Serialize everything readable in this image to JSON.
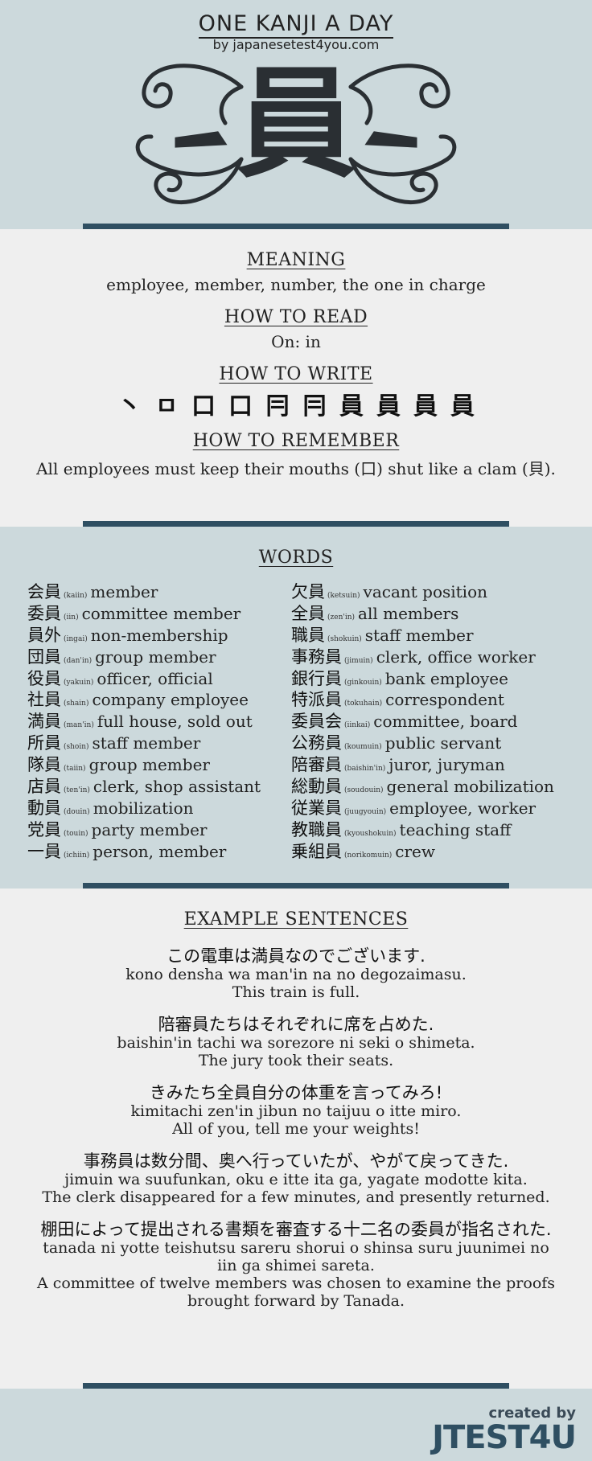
{
  "header": {
    "title": "ONE KANJI A DAY",
    "subtitle": "by japanesetest4you.com",
    "kanji": "員"
  },
  "sections": {
    "meaning_heading": "MEANING",
    "meaning": "employee, member, number, the one in charge",
    "read_heading": "HOW TO READ",
    "reading": "On: in",
    "write_heading": "HOW TO WRITE",
    "strokes": [
      "丶",
      "ㅁ",
      "口",
      "口",
      "冃",
      "冃",
      "員",
      "員",
      "員",
      "員"
    ],
    "remember_heading": "HOW TO REMEMBER",
    "remember": "All employees must keep their mouths (口) shut like a clam (貝)."
  },
  "words": {
    "heading": "WORDS",
    "left": [
      {
        "kanji": "会員",
        "reading": "(kaiin)",
        "meaning": "member"
      },
      {
        "kanji": "委員",
        "reading": "(iin)",
        "meaning": "committee member"
      },
      {
        "kanji": "員外",
        "reading": "(ingai)",
        "meaning": "non-membership"
      },
      {
        "kanji": "団員",
        "reading": "(dan'in)",
        "meaning": "group member"
      },
      {
        "kanji": "役員",
        "reading": "(yakuin)",
        "meaning": "officer, official"
      },
      {
        "kanji": "社員",
        "reading": "(shain)",
        "meaning": "company employee"
      },
      {
        "kanji": "満員",
        "reading": "(man'in)",
        "meaning": "full house, sold out"
      },
      {
        "kanji": "所員",
        "reading": "(shoin)",
        "meaning": "staff member"
      },
      {
        "kanji": "隊員",
        "reading": "(taiin)",
        "meaning": "group member"
      },
      {
        "kanji": "店員",
        "reading": "(ten'in)",
        "meaning": "clerk, shop assistant"
      },
      {
        "kanji": "動員",
        "reading": "(douin)",
        "meaning": "mobilization"
      },
      {
        "kanji": "党員",
        "reading": "(touin)",
        "meaning": "party member"
      },
      {
        "kanji": "一員",
        "reading": "(ichiin)",
        "meaning": "person, member"
      }
    ],
    "right": [
      {
        "kanji": "欠員",
        "reading": "(ketsuin)",
        "meaning": "vacant position"
      },
      {
        "kanji": "全員",
        "reading": "(zen'in)",
        "meaning": "all members"
      },
      {
        "kanji": "職員",
        "reading": "(shokuin)",
        "meaning": "staff member"
      },
      {
        "kanji": "事務員",
        "reading": "(jimuin)",
        "meaning": "clerk, office worker"
      },
      {
        "kanji": "銀行員",
        "reading": "(ginkouin)",
        "meaning": "bank employee"
      },
      {
        "kanji": "特派員",
        "reading": "(tokuhain)",
        "meaning": "correspondent"
      },
      {
        "kanji": "委員会",
        "reading": "(iinkai)",
        "meaning": "committee, board"
      },
      {
        "kanji": "公務員",
        "reading": "(koumuin)",
        "meaning": "public servant"
      },
      {
        "kanji": "陪審員",
        "reading": "(baishin'in)",
        "meaning": "juror, juryman"
      },
      {
        "kanji": "総動員",
        "reading": "(soudouin)",
        "meaning": "general mobilization"
      },
      {
        "kanji": "従業員",
        "reading": "(juugyouin)",
        "meaning": "employee, worker"
      },
      {
        "kanji": "教職員",
        "reading": "(kyoushokuin)",
        "meaning": "teaching staff"
      },
      {
        "kanji": "乗組員",
        "reading": "(norikomuin)",
        "meaning": "crew"
      }
    ]
  },
  "examples": {
    "heading": "EXAMPLE SENTENCES",
    "items": [
      {
        "jp": "この電車は満員なのでございます.",
        "romaji": "kono densha wa man'in na no degozaimasu.",
        "en": "This train is full."
      },
      {
        "jp": "陪審員たちはそれぞれに席を占めた.",
        "romaji": "baishin'in tachi wa sorezore ni seki o shimeta.",
        "en": "The jury took their seats."
      },
      {
        "jp": "きみたち全員自分の体重を言ってみろ!",
        "romaji": "kimitachi zen'in jibun no taijuu o itte miro.",
        "en": "All of you, tell me your weights!"
      },
      {
        "jp": "事務員は数分間、奥へ行っていたが、やがて戻ってきた.",
        "romaji": "jimuin wa suufunkan, oku e itte ita ga, yagate modotte kita.",
        "en": "The clerk disappeared for a few minutes, and presently returned."
      },
      {
        "jp": "棚田によって提出される書類を審査する十二名の委員が指名された.",
        "romaji": "tanada ni yotte teishutsu sareru shorui o shinsa suru juunimei no iin ga shimei sareta.",
        "en": "A committee of twelve members was chosen to examine the proofs brought forward by Tanada."
      }
    ]
  },
  "footer": {
    "credit_small": "created by",
    "credit_big": "JTEST4U"
  }
}
